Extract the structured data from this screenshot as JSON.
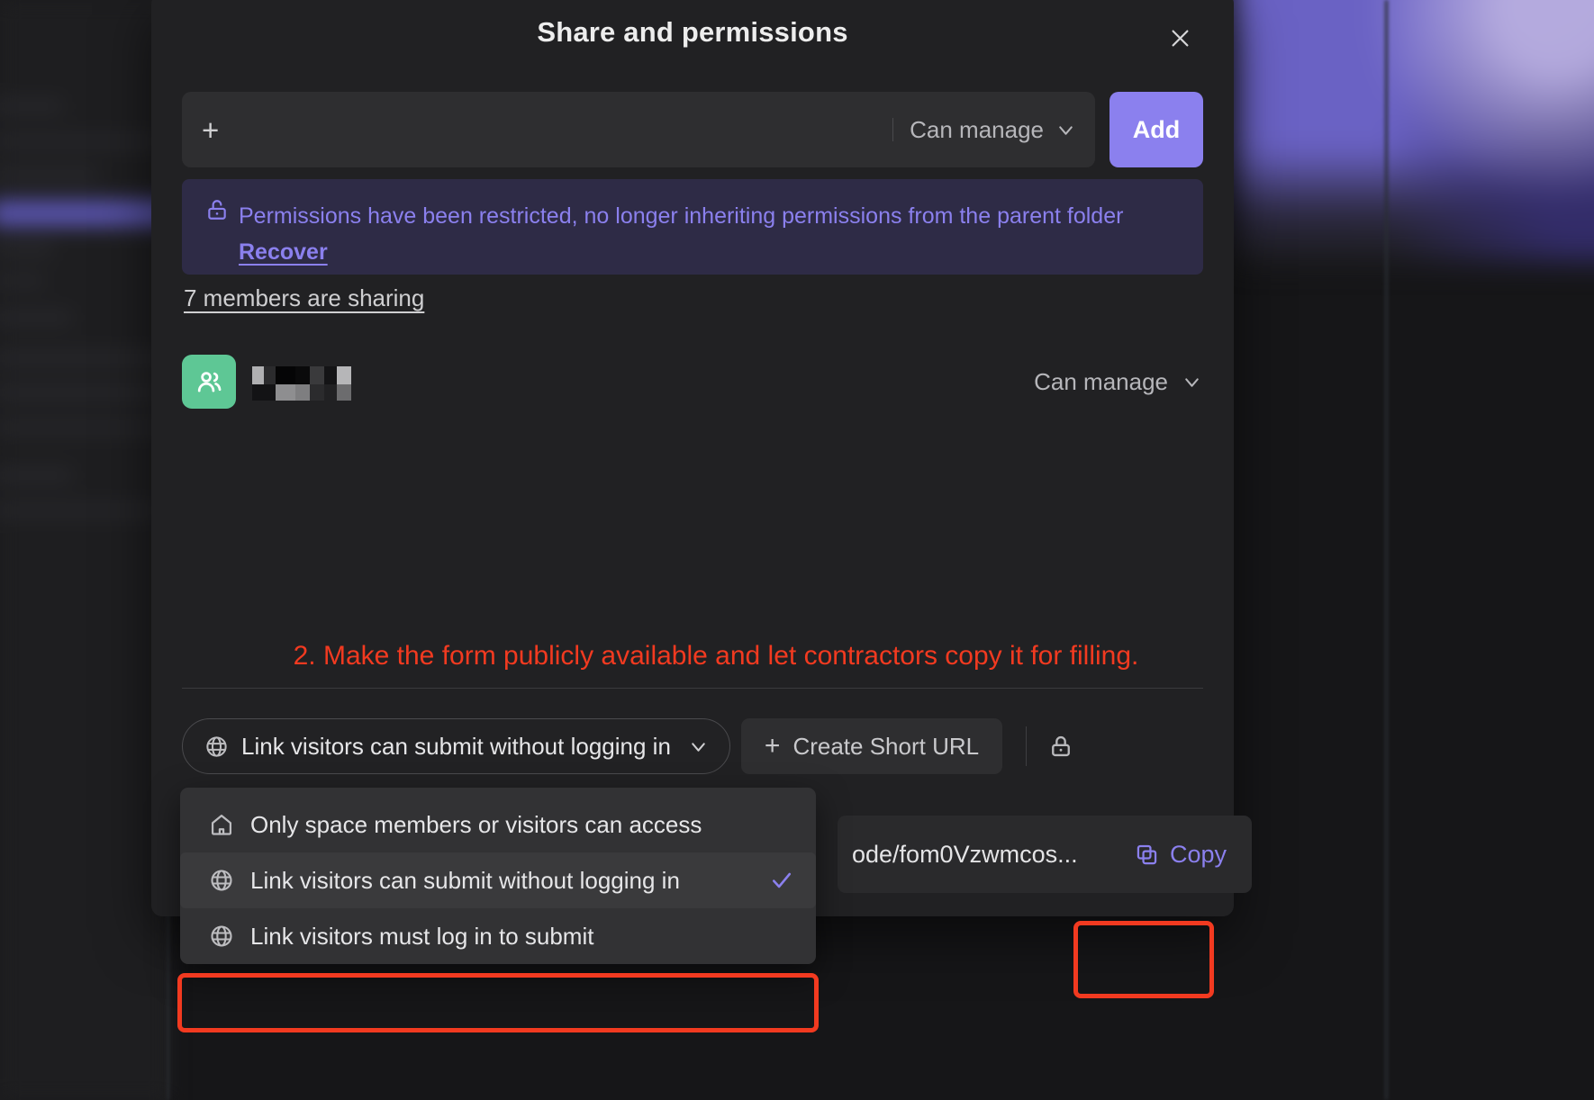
{
  "dialog": {
    "title": "Share and permissions",
    "close_icon": "close-icon",
    "invite": {
      "add_icon": "plus-icon",
      "permission_value": "Can manage",
      "chevron_icon": "chevron-down-icon",
      "add_label": "Add"
    },
    "banner": {
      "lock_icon": "lock-open-icon",
      "text": "Permissions have been restricted, no longer inheriting permissions from the parent folder ",
      "link_label": "Recover",
      "color": "#8b80ee",
      "background": "#2e2b46"
    },
    "members_link": "7 members are sharing",
    "member_row": {
      "avatar_icon": "group-icon",
      "avatar_color": "#5ec795",
      "name": "",
      "name_redacted": true,
      "permission_value": "Can manage",
      "chevron_icon": "chevron-down-icon"
    },
    "annotation": {
      "text": "2. Make the form publicly available and let contractors copy it for filling.",
      "color": "#f23a20"
    },
    "link_row": {
      "globe_icon": "globe-icon",
      "visibility_value": "Link visitors can submit without logging in",
      "chevron_icon": "chevron-down-icon",
      "create_short_url_label": "Create Short URL",
      "create_short_url_icon": "plus-icon",
      "lock_icon": "lock-closed-icon"
    },
    "url_bar": {
      "url_text": "ode/fom0Vzwmcos...",
      "copy_label": "Copy",
      "copy_icon": "copy-icon",
      "copy_color": "#8b80ee"
    },
    "dropdown": {
      "items": [
        {
          "icon": "home-icon",
          "label": "Only space members or visitors can access",
          "selected": false
        },
        {
          "icon": "globe-icon",
          "label": "Link visitors can submit without logging in",
          "selected": true
        },
        {
          "icon": "globe-icon",
          "label": "Link visitors must log in to submit",
          "selected": false
        }
      ]
    }
  }
}
